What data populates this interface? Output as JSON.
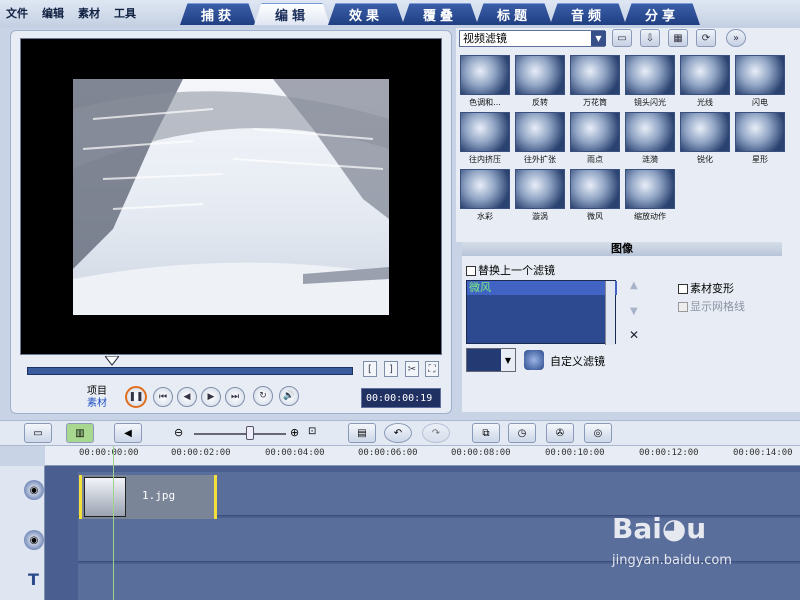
{
  "menu": [
    "文件",
    "编辑",
    "素材",
    "工具"
  ],
  "tabs": [
    "捕获",
    "编辑",
    "效果",
    "覆叠",
    "标题",
    "音频",
    "分享"
  ],
  "active_tab": "编辑",
  "preview": {
    "mode_project": "项目",
    "mode_clip": "素材",
    "timecode": "00:00:00:19"
  },
  "effects": {
    "category": "视频滤镜",
    "items": [
      "色调和...",
      "反转",
      "万花筒",
      "镜头闪光",
      "光线",
      "闪电",
      "往内挤压",
      "往外扩张",
      "雨点",
      "涟漪",
      "锐化",
      "星形",
      "水彩",
      "漩涡",
      "微风",
      "缩放动作"
    ]
  },
  "properties": {
    "header": "图像",
    "replace_label": "替换上一个滤镜",
    "filters": [
      "微风"
    ],
    "deform_label": "素材变形",
    "grid_label": "显示网格线",
    "custom_label": "自定义滤镜"
  },
  "timeline": {
    "ruler": [
      "00:00:00:00",
      "00:00:02:00",
      "00:00:04:00",
      "00:00:06:00",
      "00:00:08:00",
      "00:00:10:00",
      "00:00:12:00",
      "00:00:14:00"
    ],
    "clip_name": "1.jpg"
  },
  "watermark": "jingyan.baidu.com",
  "colors": {
    "accent_blue": "#203f82",
    "clip_edge": "#f4e03a",
    "filter_text": "#7cf07c"
  }
}
